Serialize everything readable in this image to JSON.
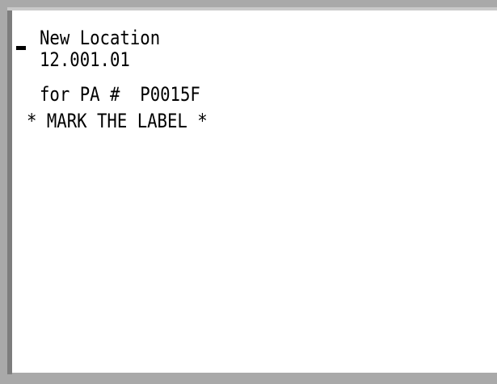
{
  "terminal": {
    "lines": {
      "title": "New Location",
      "location": "12.001.01",
      "pa_line": "for PA #  P0015F",
      "instruction": "* MARK THE LABEL *"
    }
  }
}
